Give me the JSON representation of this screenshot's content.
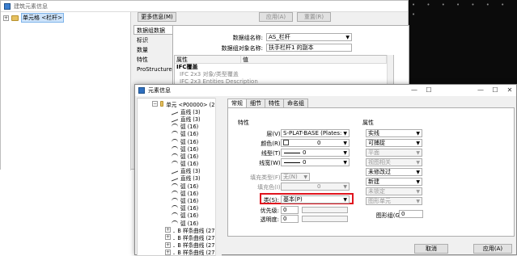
{
  "back_window": {
    "title": "建筑元素信息",
    "tree_root": "单元格 <栏杆>",
    "buttons": {
      "more": "更多信息(M)",
      "apply": "应用(A)",
      "reset": "重置(R)"
    },
    "side_tabs": [
      "数据组数据",
      "标识",
      "数量",
      "特性",
      "ProStructures"
    ],
    "fields": {
      "group_label": "数据组名称:",
      "group_value": "AS_栏杆",
      "object_label": "数据组对象名称:",
      "object_value": "扶手栏杆1 的副本"
    },
    "prop_headers": [
      "属性",
      "值"
    ],
    "prop_rows": [
      "IFC覆盖",
      "IFC 2x3 对象/类型覆盖",
      "IFC 2x3 Entities Description"
    ]
  },
  "dark_panel": {
    "dots": "• • • • • • • •"
  },
  "front_window": {
    "title": "元素信息",
    "controls": {
      "minimize": "—",
      "maximize": "☐",
      "close": "✕"
    },
    "tree": {
      "root": "单元 <P00000> (2)",
      "items": [
        {
          "type": "line",
          "label": "直线 (3)"
        },
        {
          "type": "line",
          "label": "直线 (3)"
        },
        {
          "type": "arc",
          "label": "弧 (16)"
        },
        {
          "type": "arc",
          "label": "弧 (16)"
        },
        {
          "type": "arc",
          "label": "弧 (16)"
        },
        {
          "type": "arc",
          "label": "弧 (16)"
        },
        {
          "type": "arc",
          "label": "弧 (16)"
        },
        {
          "type": "arc",
          "label": "弧 (16)"
        },
        {
          "type": "line",
          "label": "直线 (3)"
        },
        {
          "type": "line",
          "label": "直线 (3)"
        },
        {
          "type": "arc",
          "label": "弧 (16)"
        },
        {
          "type": "arc",
          "label": "弧 (16)"
        },
        {
          "type": "arc",
          "label": "弧 (16)"
        },
        {
          "type": "arc",
          "label": "弧 (16)"
        },
        {
          "type": "arc",
          "label": "弧 (16)"
        },
        {
          "type": "arc",
          "label": "弧 (16)"
        },
        {
          "type": "curve",
          "label": "B 样条曲线 (27)"
        },
        {
          "type": "curve",
          "label": "B 样条曲线 (27)"
        },
        {
          "type": "curve",
          "label": "B 样条曲线 (27)"
        },
        {
          "type": "curve",
          "label": "B 样条曲线 (27)"
        },
        {
          "type": "curve",
          "label": "B 样条曲线 (27)"
        }
      ]
    },
    "tabs": [
      "常规",
      "细节",
      "特性",
      "命名组"
    ],
    "left_group": {
      "title": "特性",
      "level_label": "层(V):",
      "level_value": "S-PLAT-BASE (Plates: Base",
      "color_label": "颜色(R):",
      "color_value": "0",
      "linestyle_label": "线型(T):",
      "linestyle_value": "0",
      "weight_label": "线宽(W):",
      "weight_value": "0",
      "fill_type_label": "填充类型(F):",
      "fill_type_value": "无(N)",
      "fill_color_label": "填充色(I):",
      "fill_color_value": "0",
      "class_label": "类(S):",
      "class_value": "基本(P)",
      "priority_label": "优先级:",
      "priority_value": "0",
      "transparency_label": "透明度:",
      "transparency_value": "0"
    },
    "right_group": {
      "title": "属性",
      "options": [
        "实线",
        "可捕捉",
        "平面",
        "视图相关",
        "未修改过",
        "新建",
        "未锁定",
        "图形单元"
      ],
      "graphic_group_label": "图形组(G):",
      "graphic_group_value": "0"
    },
    "buttons": {
      "cancel": "取消",
      "apply": "应用(A)"
    }
  },
  "colors": {
    "highlight": "#e0141e",
    "selection": "#cde3fa"
  }
}
